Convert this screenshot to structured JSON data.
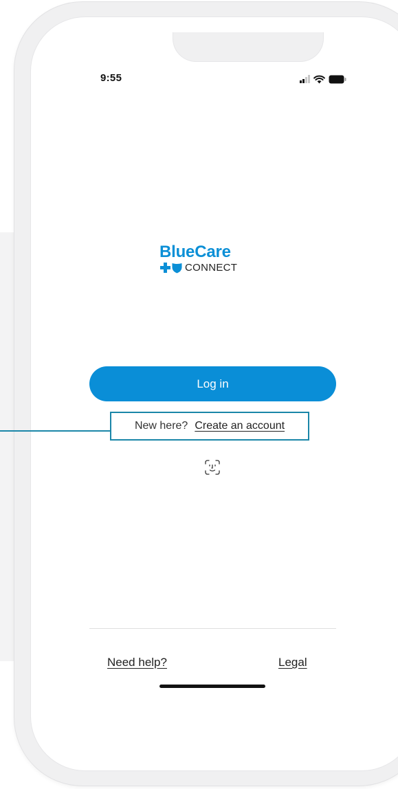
{
  "status_bar": {
    "time": "9:55",
    "icons": [
      "signal-icon",
      "wifi-icon",
      "battery-icon"
    ]
  },
  "logo": {
    "title": "BlueCare",
    "subtitle": "CONNECT",
    "icons": [
      "cross-icon",
      "shield-icon"
    ]
  },
  "login": {
    "button_label": "Log in"
  },
  "signup": {
    "prompt": "New here?",
    "link_label": "Create an account"
  },
  "biometric": {
    "icon": "face-id-icon"
  },
  "footer": {
    "help_label": "Need help?",
    "legal_label": "Legal"
  },
  "colors": {
    "brand_blue": "#0a8ed7",
    "callout_teal": "#1a86a8"
  }
}
